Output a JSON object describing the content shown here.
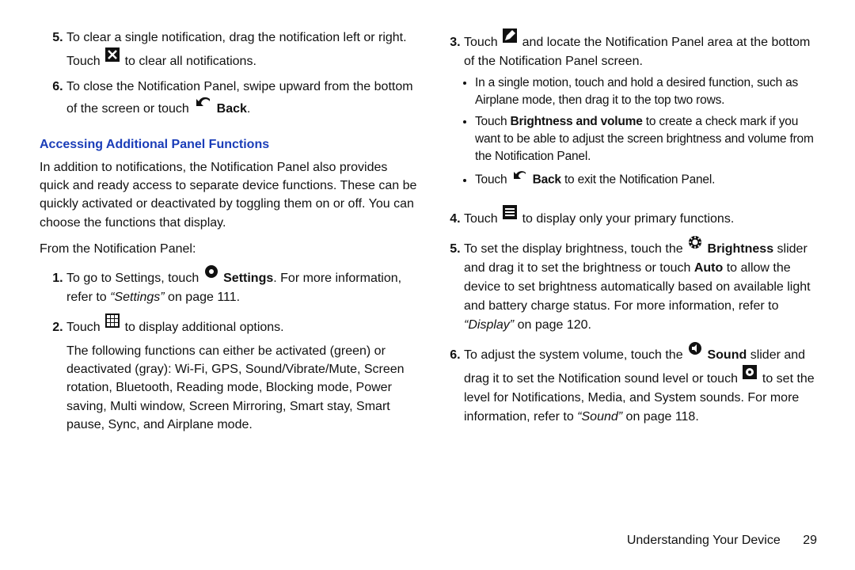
{
  "footer": {
    "section": "Understanding Your Device",
    "page": "29"
  },
  "left": {
    "item5a": "To clear a single notification, drag the notification left or right. Touch ",
    "item5b": " to clear all notifications.",
    "item6a": "To close the Notification Panel, swipe upward from the bottom of the screen or touch ",
    "back": "Back",
    "item6b": ".",
    "section_title": "Accessing Additional Panel Functions",
    "intro": "In addition to notifications, the Notification Panel also provides quick and ready access to separate device functions. These can be quickly activated or deactivated by toggling them on or off. You can choose the functions that display.",
    "leadin": "From the Notification Panel:",
    "l1a": "To go to Settings, touch ",
    "l1_settings": "Settings",
    "l1b": ". For more information, refer to ",
    "l1_ref": "“Settings”",
    "l1c": " on page 111.",
    "l2a": "Touch ",
    "l2b": " to display additional options.",
    "l2_para": "The following functions can either be activated (green) or deactivated (gray): Wi-Fi, GPS, Sound/Vibrate/Mute, Screen rotation, Bluetooth, Reading mode, Blocking mode, Power saving, Multi window, Screen Mirroring, Smart stay, Smart pause, Sync, and Airplane mode."
  },
  "right": {
    "r3a": "Touch ",
    "r3b": " and locate the Notification Panel area at the bottom of the Notification Panel screen.",
    "r3_b1": "In a single motion, touch and hold a desired function, such as Airplane mode, then drag it to the top two rows.",
    "r3_b2a": "Touch ",
    "r3_b2_bold": "Brightness and volume",
    "r3_b2b": " to create a check mark if you want to be able to adjust the screen brightness and volume from the Notification Panel.",
    "r3_b3a": "Touch ",
    "r3_b3_back": "Back",
    "r3_b3b": " to exit the Notification Panel.",
    "r4a": "Touch ",
    "r4b": " to display only your primary functions.",
    "r5a": "To set the display brightness, touch the ",
    "r5_bold": "Brightness",
    "r5b": " slider and drag it to set the brightness or touch ",
    "r5_auto": "Auto",
    "r5c": " to allow the device to set brightness automatically based on available light and battery charge status. For more information, refer to ",
    "r5_ref": "“Display”",
    "r5d": " on page 120.",
    "r6a": "To adjust the system volume, touch the ",
    "r6_bold": "Sound",
    "r6b": " slider and drag it to set the Notification sound level or touch ",
    "r6c": " to set the level for Notifications, Media, and System sounds. For more information, refer to ",
    "r6_ref": "“Sound”",
    "r6d": " on page 118."
  }
}
